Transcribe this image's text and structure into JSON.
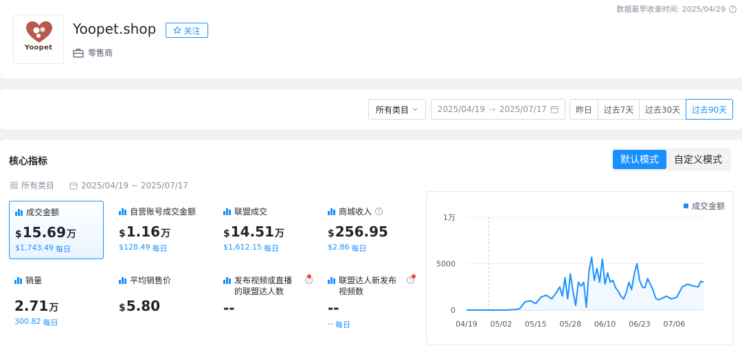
{
  "shop": {
    "logo_text": "Yoopet",
    "name": "Yoopet.shop",
    "follow_label": "关注",
    "type_label": "零售商",
    "data_time": "数据最早收录时间: 2025/04/29"
  },
  "filters": {
    "category": "所有类目",
    "date_start": "2025/04/19",
    "date_end": "2025/07/17",
    "arrow": "→",
    "quick": [
      "昨日",
      "过去7天",
      "过去30天",
      "过去90天"
    ],
    "quick_active": "过去90天"
  },
  "metrics_section": {
    "title": "核心指标",
    "modes": [
      "默认模式",
      "自定义模式"
    ],
    "active_mode": "默认模式",
    "sub_category": "所有类目",
    "sub_date": "2025/04/19 ~ 2025/07/17"
  },
  "metrics": [
    {
      "label": "成交金额",
      "currency": "$",
      "value": "15.69",
      "unit": "万",
      "daily_value": "$1,743.49",
      "daily_label": "每日",
      "active": true
    },
    {
      "label": "自营账号成交金额",
      "currency": "$",
      "value": "1.16",
      "unit": "万",
      "daily_value": "$128.49",
      "daily_label": "每日"
    },
    {
      "label": "联盟成交",
      "currency": "$",
      "value": "14.51",
      "unit": "万",
      "daily_value": "$1,612.15",
      "daily_label": "每日"
    },
    {
      "label": "商城收入",
      "currency": "$",
      "value": "256.95",
      "unit": "",
      "daily_value": "$2.86",
      "daily_label": "每日",
      "help": "?"
    },
    {
      "label": "销量",
      "currency": "",
      "value": "2.71",
      "unit": "万",
      "daily_value": "300.82",
      "daily_label": "每日"
    },
    {
      "label": "平均销售价",
      "currency": "$",
      "value": "5.80",
      "unit": "",
      "daily_value": "",
      "daily_label": ""
    },
    {
      "label": "发布视频或直播的联盟达人数",
      "currency": "",
      "value": "--",
      "unit": "",
      "daily_value": "",
      "daily_label": "",
      "help": "?"
    },
    {
      "label": "联盟达人新发布视频数",
      "currency": "",
      "value": "--",
      "unit": "",
      "daily_value": "--",
      "daily_label": "每日",
      "help": "?"
    }
  ],
  "colors": {
    "accent": "#1890ff",
    "alert": "#f53f3f"
  },
  "icons": {
    "follow": "star-outline-icon",
    "shop_type": "briefcase-icon",
    "help": "question-circle-icon",
    "category": "grid-icon",
    "calendar": "calendar-icon",
    "metric": "bar-chart-icon"
  },
  "chart_data": {
    "type": "line",
    "legend": [
      "成交金额"
    ],
    "legend_position": "top-right",
    "y_ticks": [
      "0",
      "5000",
      "1万"
    ],
    "ylim": [
      0,
      10000
    ],
    "x_ticks": [
      "04/19",
      "05/02",
      "05/15",
      "05/28",
      "06/10",
      "06/23",
      "07/06"
    ],
    "grid": true,
    "series": [
      {
        "name": "成交金额",
        "x": [
          "04/19",
          "04/22",
          "04/25",
          "04/28",
          "05/01",
          "05/04",
          "05/07",
          "05/09",
          "05/11",
          "05/13",
          "05/15",
          "05/17",
          "05/19",
          "05/21",
          "05/23",
          "05/24",
          "05/25",
          "05/26",
          "05/27",
          "05/28",
          "05/29",
          "05/30",
          "05/31",
          "06/01",
          "06/02",
          "06/03",
          "06/04",
          "06/05",
          "06/06",
          "06/07",
          "06/08",
          "06/09",
          "06/10",
          "06/11",
          "06/12",
          "06/13",
          "06/14",
          "06/15",
          "06/16",
          "06/17",
          "06/18",
          "06/19",
          "06/20",
          "06/21",
          "06/22",
          "06/23",
          "06/24",
          "06/25",
          "06/26",
          "06/27",
          "06/28",
          "06/29",
          "06/30",
          "07/01",
          "07/03",
          "07/05",
          "07/07",
          "07/09",
          "07/11",
          "07/13",
          "07/15",
          "07/16",
          "07/17"
        ],
        "y": [
          0,
          0,
          0,
          0,
          0,
          0,
          50,
          150,
          900,
          1000,
          700,
          1400,
          1600,
          1200,
          2000,
          2500,
          1500,
          3500,
          1200,
          3900,
          2000,
          500,
          3000,
          2600,
          3000,
          300,
          4200,
          5700,
          3200,
          4500,
          3000,
          5500,
          2800,
          4000,
          3000,
          3200,
          2400,
          2000,
          1500,
          1200,
          1900,
          3000,
          2200,
          3900,
          5000,
          3200,
          2500,
          2400,
          3400,
          2800,
          2200,
          1300,
          1100,
          1200,
          1500,
          1200,
          1400,
          2500,
          2800,
          2600,
          2500,
          3100,
          3000
        ]
      }
    ]
  }
}
